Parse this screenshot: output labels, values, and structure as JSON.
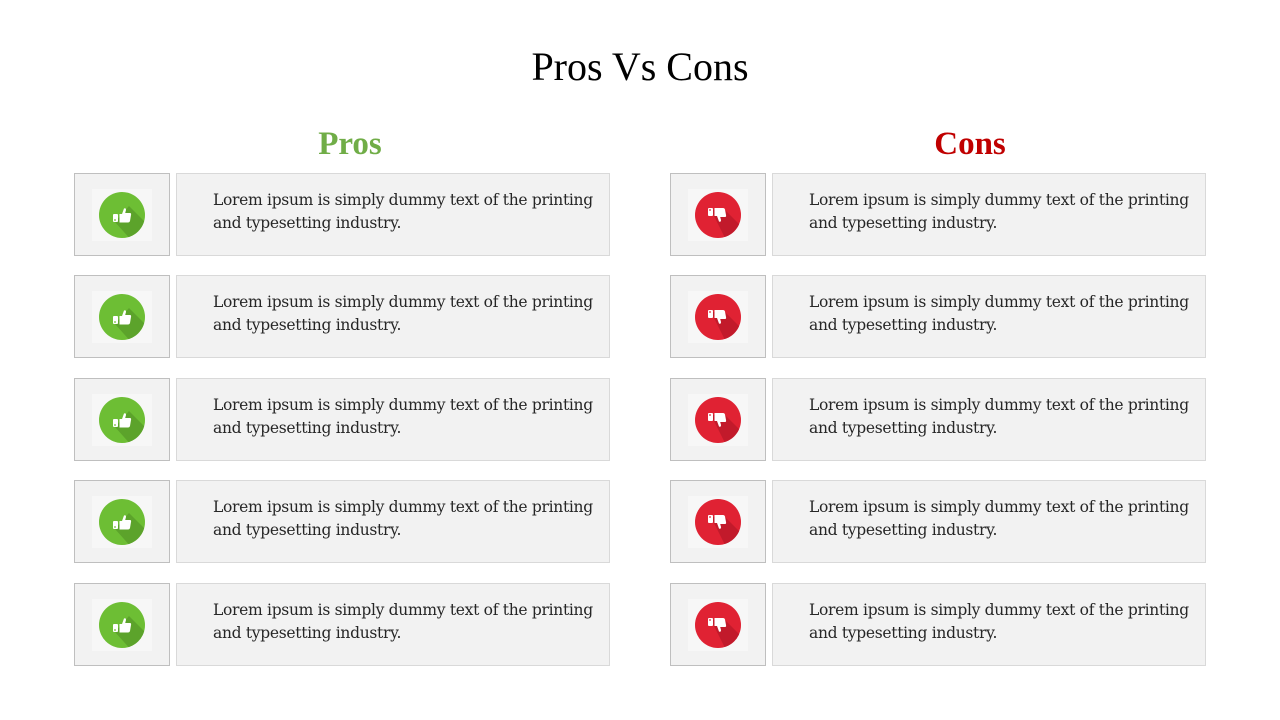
{
  "slide": {
    "title": "Pros Vs Cons"
  },
  "pros": {
    "heading": "Pros",
    "color": "#70ad47",
    "icon": "thumbs-up-icon",
    "items": [
      {
        "text": "Lorem ipsum is simply dummy text of the printing and typesetting industry."
      },
      {
        "text": "Lorem ipsum is simply dummy text of the printing and typesetting industry."
      },
      {
        "text": "Lorem ipsum is simply dummy text of the printing and typesetting industry."
      },
      {
        "text": "Lorem ipsum is simply dummy text of the printing and typesetting industry."
      },
      {
        "text": "Lorem ipsum is simply dummy text of the printing and typesetting industry."
      }
    ]
  },
  "cons": {
    "heading": "Cons",
    "color": "#c00000",
    "icon": "thumbs-down-icon",
    "items": [
      {
        "text": "Lorem ipsum is simply dummy text of the printing and typesetting industry."
      },
      {
        "text": "Lorem ipsum is simply dummy text of the printing and typesetting industry."
      },
      {
        "text": "Lorem ipsum is simply dummy text of the printing and typesetting industry."
      },
      {
        "text": "Lorem ipsum is simply dummy text of the printing and typesetting industry."
      },
      {
        "text": "Lorem ipsum is simply dummy text of the printing and typesetting industry."
      }
    ]
  }
}
